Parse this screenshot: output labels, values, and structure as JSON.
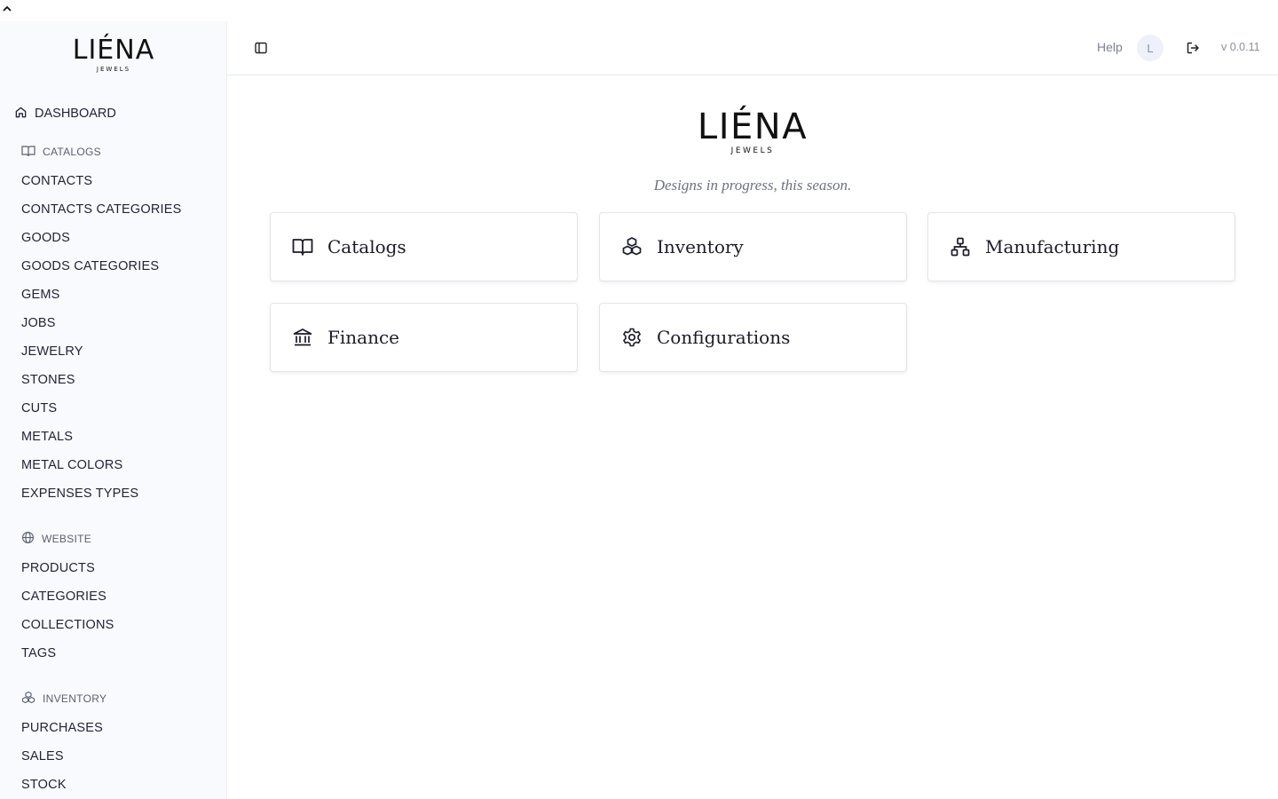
{
  "brand": {
    "name": "LIÉNA",
    "sub": "JEWELS"
  },
  "header": {
    "help": "Help",
    "avatar_initial": "L",
    "version": "v 0.0.11"
  },
  "sidebar": {
    "dashboard": "DASHBOARD",
    "sections": [
      {
        "title": "CATALOGS",
        "icon": "book-open-icon",
        "items": [
          "CONTACTS",
          "CONTACTS CATEGORIES",
          "GOODS",
          "GOODS CATEGORIES",
          "GEMS",
          "JOBS",
          "JEWELRY",
          "STONES",
          "CUTS",
          "METALS",
          "METAL COLORS",
          "EXPENSES TYPES"
        ]
      },
      {
        "title": "WEBSITE",
        "icon": "globe-icon",
        "items": [
          "PRODUCTS",
          "CATEGORIES",
          "COLLECTIONS",
          "TAGS"
        ]
      },
      {
        "title": "INVENTORY",
        "icon": "boxes-icon",
        "items": [
          "PURCHASES",
          "SALES",
          "STOCK"
        ]
      }
    ]
  },
  "main": {
    "tagline": "Designs in progress, this season.",
    "cards": [
      {
        "label": "Catalogs",
        "icon": "book-open-icon"
      },
      {
        "label": "Inventory",
        "icon": "boxes-icon"
      },
      {
        "label": "Manufacturing",
        "icon": "network-icon"
      },
      {
        "label": "Finance",
        "icon": "bank-icon"
      },
      {
        "label": "Configurations",
        "icon": "gear-icon"
      }
    ]
  },
  "colors": {
    "sidebar_bg": "#f8fafd",
    "text": "#23233a",
    "muted": "#7c8194",
    "border": "#e2e4ea"
  }
}
